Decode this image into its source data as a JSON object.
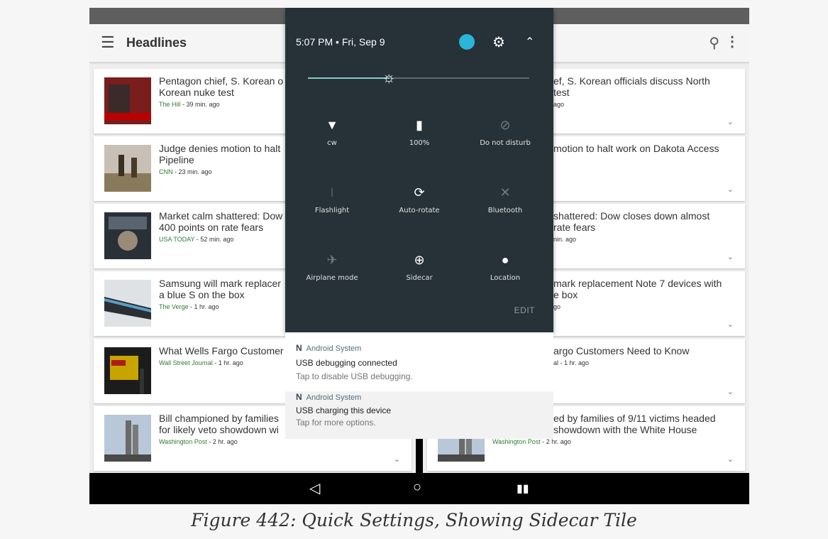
{
  "app": {
    "title": "Headlines",
    "menu_icon": "menu-icon",
    "search_icon": "search-icon",
    "more_icon": "more-vert-icon"
  },
  "left_cards": [
    {
      "headline": "Pentagon chief, S. Korean o",
      "headline2": "Korean nuke test",
      "source": "The Hill",
      "age": " - 39 min. ago"
    },
    {
      "headline": "Judge denies motion to halt",
      "headline2": "Pipeline",
      "source": "CNN",
      "age": " - 23 min. ago"
    },
    {
      "headline": "Market calm shattered: Dow",
      "headline2": "400 points on rate fears",
      "source": "USA TODAY",
      "age": " - 52 min. ago"
    },
    {
      "headline": "Samsung will mark replacer",
      "headline2": "a blue S on the box",
      "source": "The Verge",
      "age": " - 1 hr. ago"
    },
    {
      "headline": "What Wells Fargo Customer",
      "headline2": "",
      "source": "Wall Street Journal",
      "age": " - 1 hr. ago"
    },
    {
      "headline": "Bill championed by families",
      "headline2": "for likely veto showdown wi",
      "source": "Washington Post",
      "age": " - 2 hr. ago"
    }
  ],
  "right_cards": [
    {
      "headline": "ef, S. Korean officials discuss North",
      "headline2": "test",
      "meta": "ago"
    },
    {
      "headline": "motion to halt work on Dakota Access",
      "headline2": "",
      "meta": ""
    },
    {
      "headline": "shattered: Dow closes down almost",
      "headline2": "rate fears",
      "meta": "nin. ago"
    },
    {
      "headline": "mark replacement Note 7 devices with",
      "headline2": "e box",
      "meta": "go"
    },
    {
      "headline": "argo Customers Need to Know",
      "headline2": "",
      "meta": "al - 1 hr. ago"
    },
    {
      "headline": "ed by families of 9/11 victims headed",
      "headline2": "showdown with the White House",
      "meta_source": "Washington Post",
      "meta": " - 2 hr. ago"
    }
  ],
  "quick_settings": {
    "time": "5:07 PM",
    "separator": " • ",
    "date": "Fri, Sep 9",
    "brightness_percent": 37,
    "account_color": "#29b6d8",
    "tiles": [
      {
        "label": "cw",
        "icon": "wifi-icon",
        "active": true
      },
      {
        "label": "100%",
        "icon": "battery-icon",
        "active": true
      },
      {
        "label": "Do not disturb",
        "icon": "do-not-disturb-icon",
        "active": false
      },
      {
        "label": "Flashlight",
        "icon": "flashlight-icon",
        "active": false
      },
      {
        "label": "Auto-rotate",
        "icon": "auto-rotate-icon",
        "active": true
      },
      {
        "label": "Bluetooth",
        "icon": "bluetooth-icon",
        "active": false
      },
      {
        "label": "Airplane mode",
        "icon": "airplane-icon",
        "active": false
      },
      {
        "label": "Sidecar",
        "icon": "sidecar-plus-icon",
        "active": true
      },
      {
        "label": "Location",
        "icon": "location-icon",
        "active": true
      }
    ],
    "edit_label": "EDIT"
  },
  "notifications": [
    {
      "app": "Android System",
      "title": "USB debugging connected",
      "text": "Tap to disable USB debugging."
    },
    {
      "app": "Android System",
      "title": "USB charging this device",
      "text": "Tap for more options."
    }
  ],
  "caption": "Figure 442: Quick Settings, Showing Sidecar Tile",
  "colors": {
    "source_green": "#2e7d32",
    "shade_bg": "#263238",
    "slider_accent": "#80cbc4"
  }
}
